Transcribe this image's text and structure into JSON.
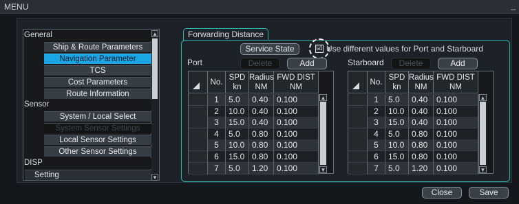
{
  "window": {
    "title": "MENU",
    "minimize_glyph": "_"
  },
  "sidebar": {
    "entries": [
      {
        "kind": "group",
        "label": "General"
      },
      {
        "kind": "item",
        "label": "Ship & Route Parameters",
        "state": "normal"
      },
      {
        "kind": "item",
        "label": "Navigation Parameter",
        "state": "selected"
      },
      {
        "kind": "item",
        "label": "TCS",
        "state": "normal"
      },
      {
        "kind": "item",
        "label": "Cost Parameters",
        "state": "normal"
      },
      {
        "kind": "item",
        "label": "Route Information",
        "state": "normal"
      },
      {
        "kind": "group",
        "label": "Sensor"
      },
      {
        "kind": "item",
        "label": "System / Local Select",
        "state": "normal"
      },
      {
        "kind": "item",
        "label": "System Sensor Settings",
        "state": "disabled"
      },
      {
        "kind": "item",
        "label": "Local Sensor Settings",
        "state": "normal"
      },
      {
        "kind": "item",
        "label": "Other Sensor Settings",
        "state": "normal"
      },
      {
        "kind": "group",
        "label": "DISP"
      },
      {
        "kind": "plain",
        "label": "Setting",
        "state": "normal"
      }
    ]
  },
  "panel": {
    "title": "Forwarding Distance",
    "service_state_label": "Service State",
    "checkbox": {
      "checked": true,
      "glyph": "☑",
      "label": "Use different values for Port and Starboard"
    },
    "port": {
      "label": "Port",
      "delete_label": "Delete",
      "add_label": "Add",
      "headers": [
        "No.",
        "SPD\nkn",
        "Radius\nNM",
        "FWD DIST\nNM"
      ],
      "rows": [
        [
          "1",
          "5.0",
          "0.40",
          "0.100"
        ],
        [
          "2",
          "10.0",
          "0.40",
          "0.100"
        ],
        [
          "3",
          "15.0",
          "0.40",
          "0.100"
        ],
        [
          "4",
          "5.0",
          "0.80",
          "0.100"
        ],
        [
          "5",
          "10.0",
          "0.80",
          "0.100"
        ],
        [
          "6",
          "15.0",
          "0.80",
          "0.100"
        ],
        [
          "7",
          "5.0",
          "1.20",
          "0.100"
        ]
      ]
    },
    "starboard": {
      "label": "Starboard",
      "delete_label": "Delete",
      "add_label": "Add",
      "headers": [
        "No.",
        "SPD\nkn",
        "Radius\nNM",
        "FWD DIST\nNM"
      ],
      "rows": [
        [
          "1",
          "5.0",
          "0.40",
          "0.100"
        ],
        [
          "2",
          "10.0",
          "0.40",
          "0.100"
        ],
        [
          "3",
          "15.0",
          "0.40",
          "0.100"
        ],
        [
          "4",
          "5.0",
          "0.80",
          "0.100"
        ],
        [
          "5",
          "10.0",
          "0.80",
          "0.100"
        ],
        [
          "6",
          "15.0",
          "0.80",
          "0.100"
        ],
        [
          "7",
          "5.0",
          "1.20",
          "0.100"
        ]
      ]
    }
  },
  "footer": {
    "close_label": "Close",
    "save_label": "Save"
  },
  "icons": {
    "scroll_up": "▲",
    "scroll_down": "▼",
    "sort_corner": "corner-triangle-icon"
  },
  "colors": {
    "accent": "#1aa6e6",
    "frame": "#2fb5ad"
  }
}
